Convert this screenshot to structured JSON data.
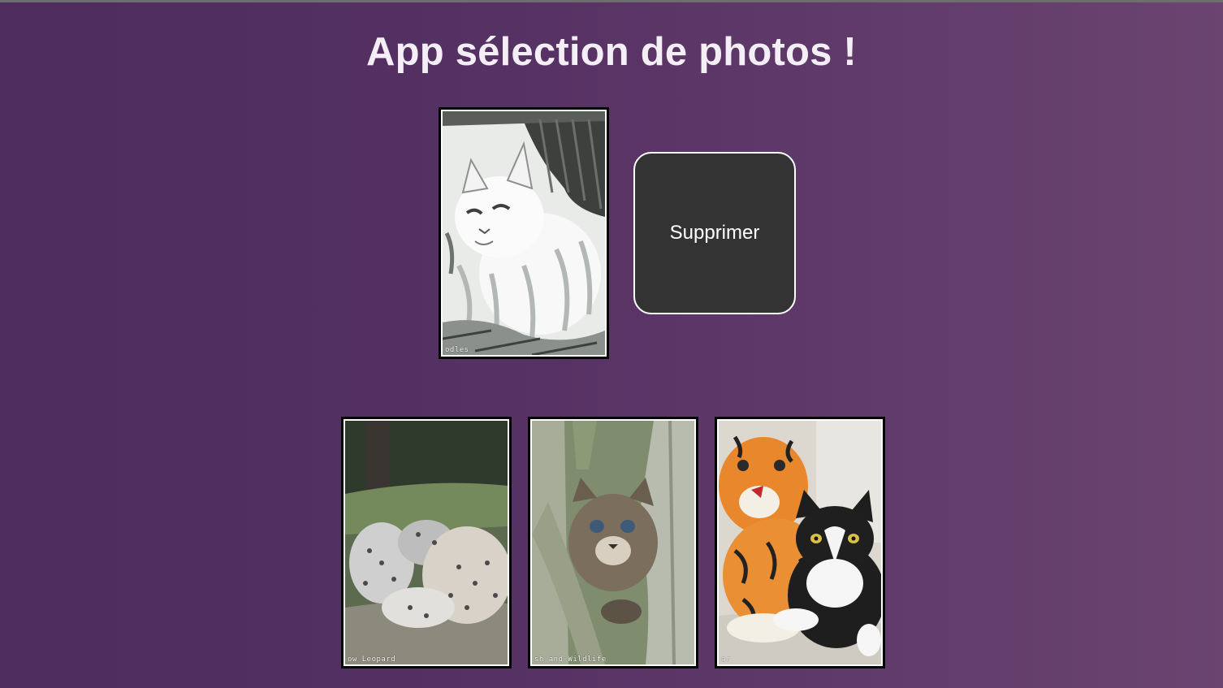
{
  "app": {
    "title": "App sélection de photos !"
  },
  "selected_photo": {
    "caption": "odles"
  },
  "actions": {
    "delete_label": "Supprimer"
  },
  "gallery": [
    {
      "caption": "ow Leopard"
    },
    {
      "caption": "sh and Wildlife"
    },
    {
      "caption": "ar"
    }
  ],
  "colors": {
    "background_start": "#4d2c5e",
    "background_end": "#6b4470",
    "button_bg": "#333333",
    "button_border": "#ffffff",
    "title_text": "#f4eef6"
  }
}
